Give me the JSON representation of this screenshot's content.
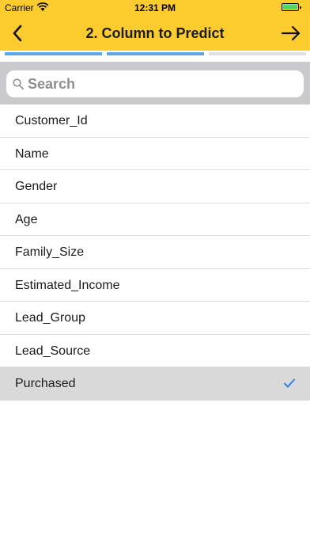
{
  "status_bar": {
    "carrier": "Carrier",
    "time": "12:31 PM",
    "battery_level": 1.0,
    "icons": [
      "wifi-icon",
      "battery-icon",
      "charging-icon"
    ]
  },
  "nav": {
    "title": "2. Column to Predict",
    "back_icon": "chevron-left-icon",
    "next_icon": "arrow-right-icon"
  },
  "progress": {
    "steps_total": 3,
    "steps_completed": 2,
    "active_color": "#5aa9e6",
    "inactive_color": "#e0e0e0"
  },
  "search": {
    "placeholder": "Search",
    "value": "",
    "icon": "search-icon"
  },
  "columns": [
    {
      "label": "Customer_Id",
      "selected": false
    },
    {
      "label": "Name",
      "selected": false
    },
    {
      "label": "Gender",
      "selected": false
    },
    {
      "label": "Age",
      "selected": false
    },
    {
      "label": "Family_Size",
      "selected": false
    },
    {
      "label": "Estimated_Income",
      "selected": false
    },
    {
      "label": "Lead_Group",
      "selected": false
    },
    {
      "label": "Lead_Source",
      "selected": false
    },
    {
      "label": "Purchased",
      "selected": true
    }
  ],
  "colors": {
    "header": "#fccb2e",
    "checkmark": "#2f7de1",
    "selected_row": "#d9d9d9"
  }
}
